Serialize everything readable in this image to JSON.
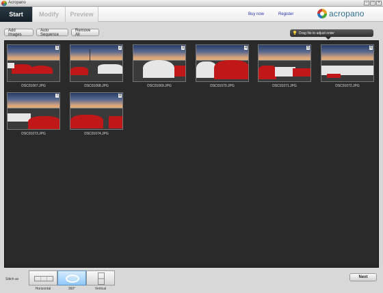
{
  "window": {
    "title": "Acropano",
    "controls": [
      "minimize",
      "maximize",
      "close"
    ]
  },
  "header": {
    "tabs": [
      {
        "label": "Start",
        "active": true
      },
      {
        "label": "Modify",
        "active": false
      },
      {
        "label": "Preview",
        "active": false
      }
    ],
    "buy_now": "Buy now",
    "register": "Register",
    "logo_text": "acropano"
  },
  "toolbar": {
    "add_images": "Add Images",
    "auto_sequence": "Auto Sequence",
    "remove_all": "Remove All",
    "hint": "Drag file to adjust order",
    "hint_icon": "lightbulb-icon"
  },
  "images": [
    {
      "index": "1",
      "filename": "DSC01067.JPG"
    },
    {
      "index": "2",
      "filename": "DSC01068.JPG"
    },
    {
      "index": "3",
      "filename": "DSC01069.JPG"
    },
    {
      "index": "4",
      "filename": "DSC01070.JPG"
    },
    {
      "index": "5",
      "filename": "DSC01071.JPG"
    },
    {
      "index": "6",
      "filename": "DSC01072.JPG"
    },
    {
      "index": "7",
      "filename": "DSC01073.JPG"
    },
    {
      "index": "8",
      "filename": "DSC01074.JPG"
    }
  ],
  "bottom": {
    "stitch_label": "Stitch as",
    "options": [
      {
        "label": "Horizontal",
        "icon": "horizontal-stitch-icon",
        "active": false
      },
      {
        "label": "360°",
        "icon": "360-stitch-icon",
        "active": true
      },
      {
        "label": "Vertical",
        "icon": "vertical-stitch-icon",
        "active": false
      }
    ],
    "next": "Next"
  }
}
